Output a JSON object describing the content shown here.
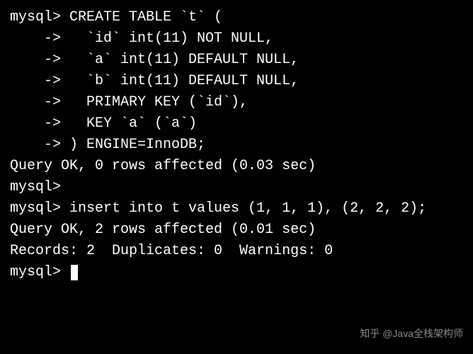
{
  "terminal": {
    "lines": [
      "mysql> CREATE TABLE `t` (",
      "    ->   `id` int(11) NOT NULL,",
      "    ->   `a` int(11) DEFAULT NULL,",
      "    ->   `b` int(11) DEFAULT NULL,",
      "    ->   PRIMARY KEY (`id`),",
      "    ->   KEY `a` (`a`)",
      "    -> ) ENGINE=InnoDB;",
      "Query OK, 0 rows affected (0.03 sec)",
      "",
      "mysql>",
      "mysql> insert into t values (1, 1, 1), (2, 2, 2);",
      "Query OK, 2 rows affected (0.01 sec)",
      "Records: 2  Duplicates: 0  Warnings: 0",
      ""
    ],
    "prompt": "mysql> "
  },
  "watermark": "知乎 @Java全栈架构师"
}
